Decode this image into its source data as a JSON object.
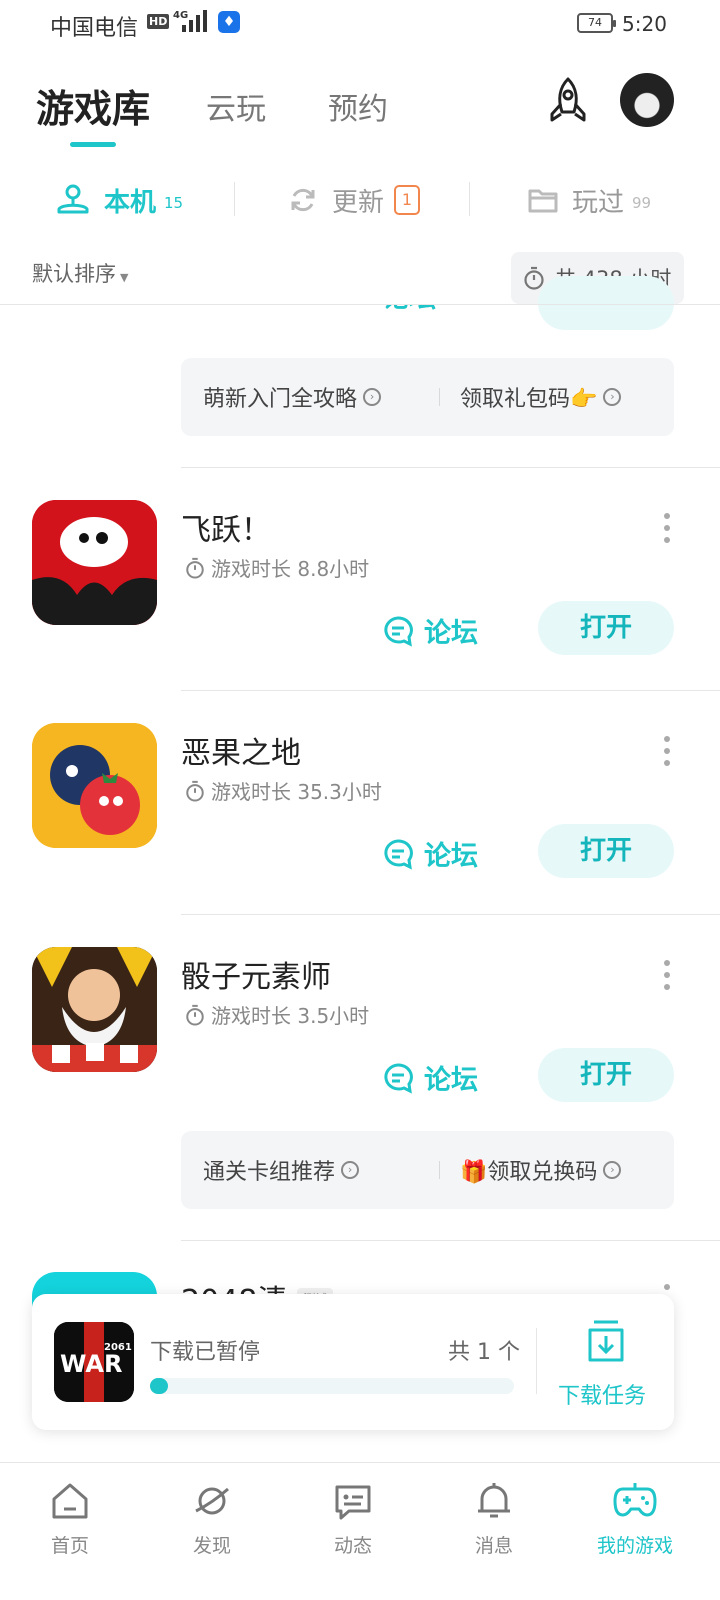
{
  "status_bar": {
    "carrier": "中国电信",
    "hd": "HD",
    "network": "4G",
    "battery": "74",
    "time": "5:20"
  },
  "top_tabs": [
    "游戏库",
    "云玩",
    "预约"
  ],
  "sub_tabs": [
    {
      "label": "本机",
      "count": "15"
    },
    {
      "label": "更新",
      "count": "1"
    },
    {
      "label": "玩过",
      "count": "99"
    }
  ],
  "sort_label": "默认排序",
  "total_hours": "共 438 小时",
  "guide_boxes": [
    {
      "left": "萌新入门全攻略",
      "right": "领取礼包码👉"
    },
    {
      "left": "通关卡组推荐",
      "right": "🎁领取兑换码"
    }
  ],
  "forum_label": "论坛",
  "open_label": "打开",
  "games": [
    {
      "name": "飞跃！",
      "playtime": "游戏时长 8.8小时"
    },
    {
      "name": "恶果之地",
      "playtime": "游戏时长 35.3小时"
    },
    {
      "name": "骰子元素师",
      "playtime": "游戏时长 3.5小时"
    },
    {
      "name": "2048清",
      "tag": "测试"
    }
  ],
  "download": {
    "status": "下载已暂停",
    "count": "共 1 个",
    "task_label": "下载任务",
    "progress": 0.03,
    "icon_text": "2061"
  },
  "bottom_nav": [
    {
      "label": "首页"
    },
    {
      "label": "发现"
    },
    {
      "label": "动态"
    },
    {
      "label": "消息"
    },
    {
      "label": "我的游戏",
      "active": true
    }
  ],
  "colors": {
    "accent": "#1ec5c9",
    "badge": "#f2874e"
  }
}
